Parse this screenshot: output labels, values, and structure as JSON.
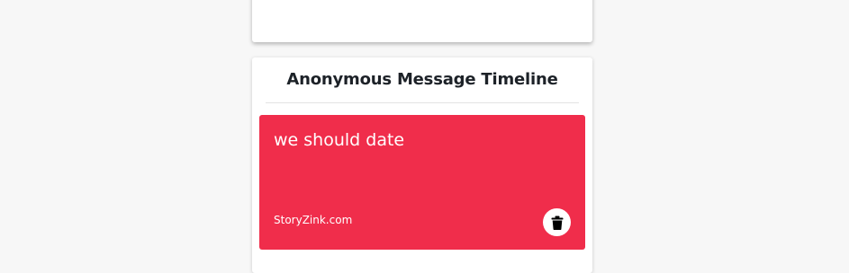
{
  "timeline": {
    "title": "Anonymous Message Timeline",
    "messages": [
      {
        "text": "we should date",
        "source": "StoryZink.com",
        "delete_icon": "trash-icon"
      }
    ]
  },
  "colors": {
    "background": "#f7f7f7",
    "card": "#ffffff",
    "message_card": "#f02d4b",
    "title_text": "#1d2228"
  }
}
